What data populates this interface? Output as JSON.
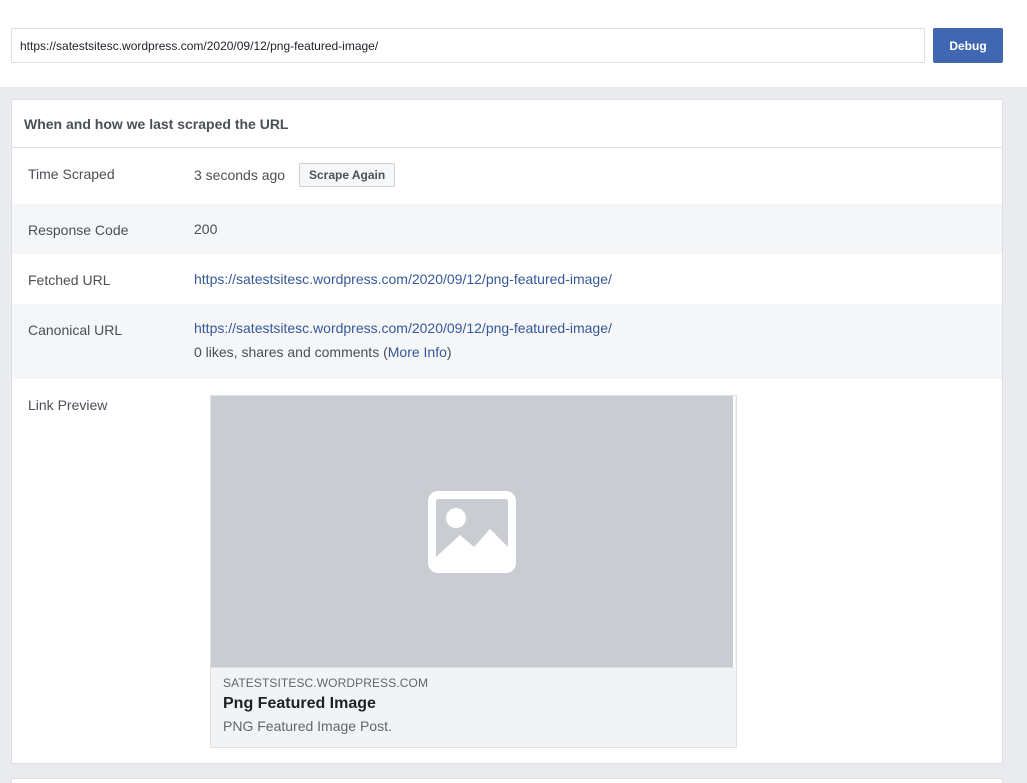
{
  "search": {
    "url_value": "https://satestsitesc.wordpress.com/2020/09/12/png-featured-image/",
    "debug_label": "Debug"
  },
  "panel": {
    "header": "When and how we last scraped the URL",
    "time_scraped": {
      "label": "Time Scraped",
      "value": "3 seconds ago",
      "button_label": "Scrape Again"
    },
    "response_code": {
      "label": "Response Code",
      "value": "200"
    },
    "fetched_url": {
      "label": "Fetched URL",
      "value": "https://satestsitesc.wordpress.com/2020/09/12/png-featured-image/"
    },
    "canonical_url": {
      "label": "Canonical URL",
      "value": "https://satestsitesc.wordpress.com/2020/09/12/png-featured-image/",
      "engagement_prefix": "0 likes, shares and comments (",
      "more_info_label": "More Info",
      "engagement_suffix": ")"
    },
    "link_preview": {
      "label": "Link Preview",
      "image_icon": "image-placeholder-icon",
      "domain": "SATESTSITESC.WORDPRESS.COM",
      "title": "Png Featured Image",
      "description": "PNG Featured Image Post."
    }
  },
  "colors": {
    "accent": "#4267b2",
    "link": "#365899",
    "background": "#e9ebee",
    "image_placeholder": "#c9ccd1"
  }
}
